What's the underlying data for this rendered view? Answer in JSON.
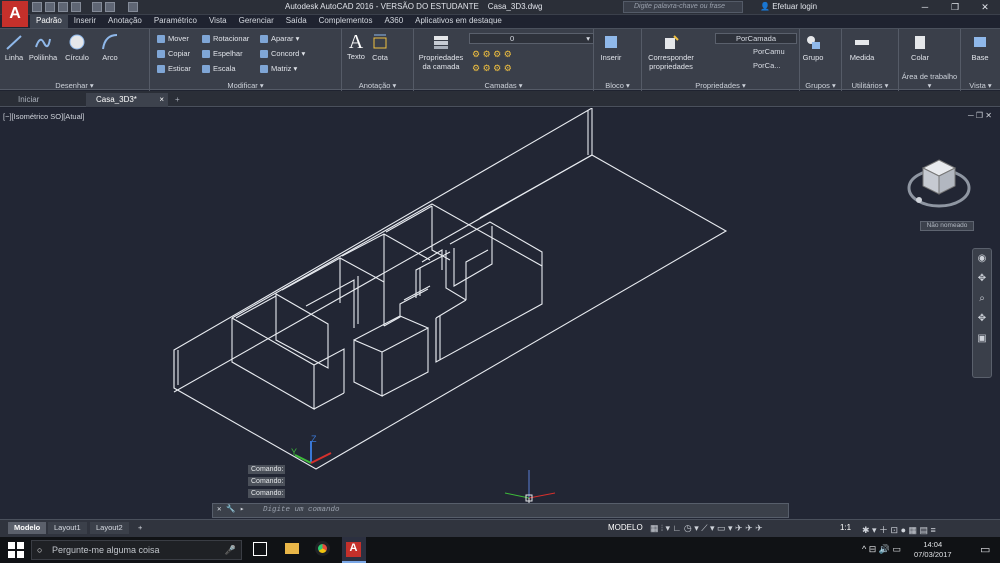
{
  "app": {
    "title": "Autodesk AutoCAD 2016 - VERSÃO DO ESTUDANTE",
    "filename": "Casa_3D3.dwg",
    "search_placeholder": "Digite palavra-chave ou frase",
    "login": "Efetuar login"
  },
  "menu_tabs": [
    "Padrão",
    "Inserir",
    "Anotação",
    "Paramétrico",
    "Vista",
    "Gerenciar",
    "Saída",
    "Complementos",
    "A360",
    "Aplicativos em destaque"
  ],
  "ribbon": {
    "desenhar": {
      "title": "Desenhar",
      "linha": "Linha",
      "polilinha": "Polilinha",
      "circulo": "Círculo",
      "arco": "Arco"
    },
    "modificar": {
      "title": "Modificar",
      "mover": "Mover",
      "rotacionar": "Rotacionar",
      "aparar": "Aparar",
      "copiar": "Copiar",
      "espelhar": "Espelhar",
      "concord": "Concord",
      "esticar": "Esticar",
      "escala": "Escala",
      "matriz": "Matriz"
    },
    "anotacao": {
      "title": "Anotação",
      "texto": "Texto",
      "cota": "Cota"
    },
    "camadas": {
      "title": "Camadas",
      "propriedades": "Propriedades",
      "da_camada": "da camada",
      "layer_value": "0"
    },
    "bloco": {
      "title": "Bloco",
      "inserir": "Inserir"
    },
    "propriedades": {
      "title": "Propriedades",
      "corresponder": "Corresponder",
      "props": "propriedades",
      "porcamada": "PorCamada",
      "porcam1": "PorCamu",
      "porcam2": "PorCa..."
    },
    "grupos": {
      "title": "Grupos",
      "grupo": "Grupo"
    },
    "utilitarios": {
      "title": "Utilitários",
      "medida": "Medida"
    },
    "area": {
      "title": "Área de trabalho",
      "colar": "Colar"
    },
    "vista": {
      "title": "Vista",
      "base": "Base"
    }
  },
  "doc_tabs": {
    "start": "Iniciar",
    "active": "Casa_3D3*",
    "add": "+"
  },
  "viewport": {
    "label": "[−][Isométrico SO][Atual]",
    "viewcube_name": "Não nomeado",
    "axis_z": "Z",
    "axis_y": "Y"
  },
  "command": {
    "history": [
      "Comando:",
      "Comando:",
      "Comando:"
    ],
    "placeholder": "Digite um comando"
  },
  "layout_tabs": [
    "Modelo",
    "Layout1",
    "Layout2"
  ],
  "status": {
    "model": "MODELO",
    "scale": "1:1"
  },
  "taskbar": {
    "search": "Pergunte-me alguma coisa",
    "time": "14:04",
    "date": "07/03/2017"
  }
}
